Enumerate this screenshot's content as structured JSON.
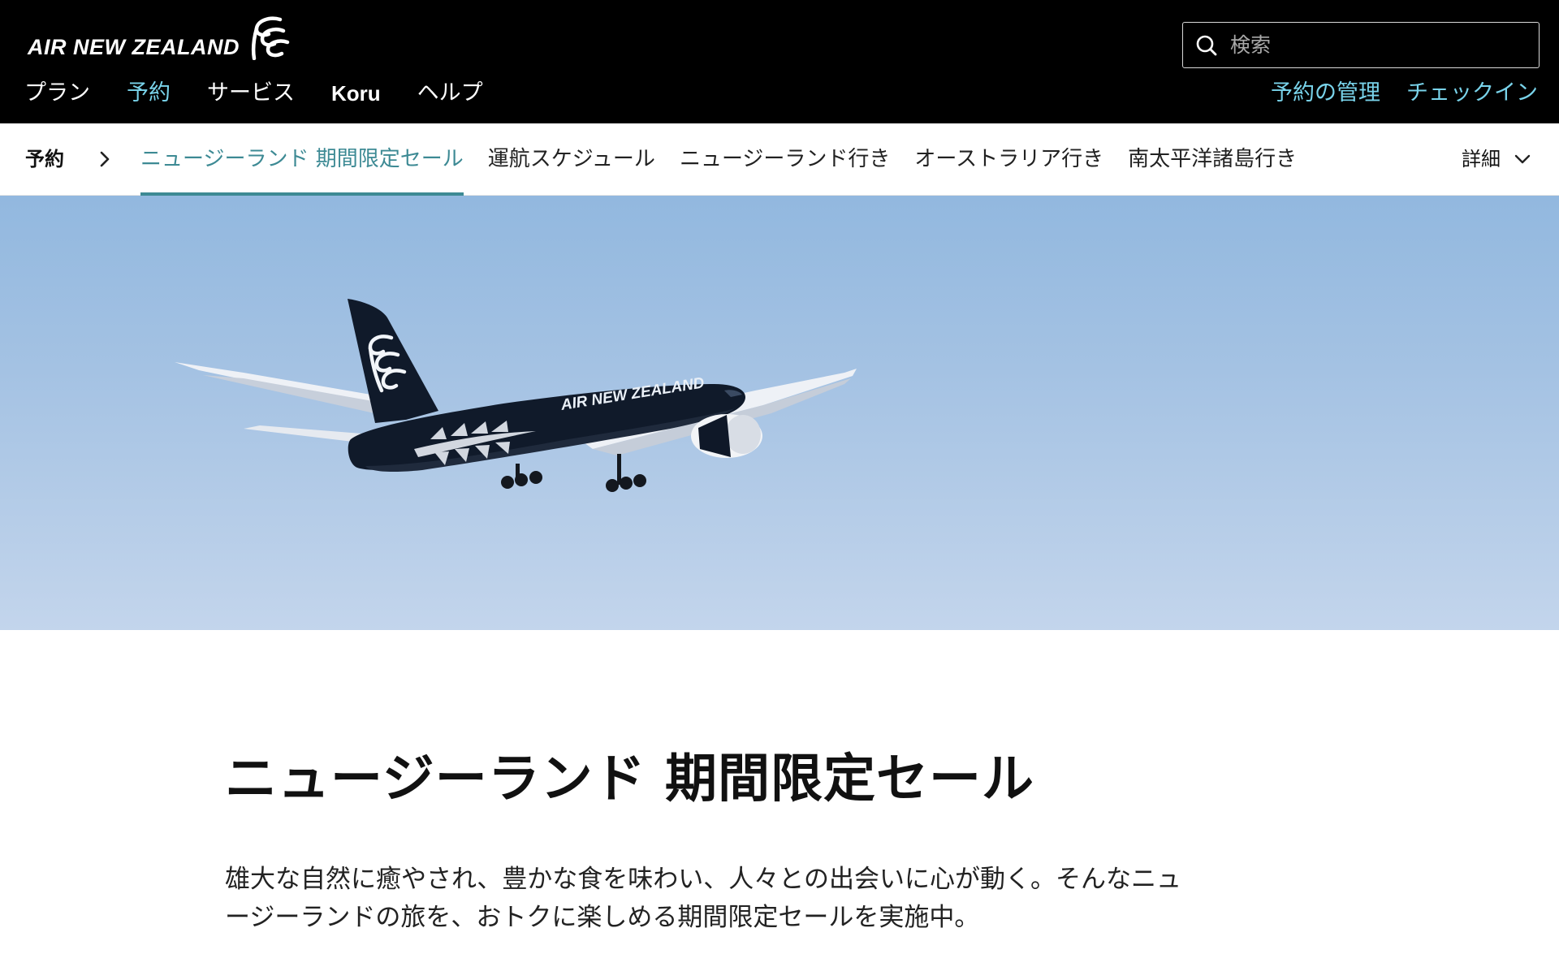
{
  "header": {
    "logo_text": "AIR NEW ZEALAND",
    "main_nav": [
      {
        "label": "プラン",
        "active": false
      },
      {
        "label": "予約",
        "active": true
      },
      {
        "label": "サービス",
        "active": false
      },
      {
        "label": "Koru",
        "active": false
      },
      {
        "label": "ヘルプ",
        "active": false
      }
    ],
    "search": {
      "placeholder": "検索",
      "value": "",
      "icon": "search-icon"
    },
    "util_nav": [
      {
        "label": "予約の管理"
      },
      {
        "label": "チェックイン"
      }
    ]
  },
  "subnav": {
    "root_label": "予約",
    "items": [
      {
        "label": "ニュージーランド 期間限定セール",
        "active": true
      },
      {
        "label": "運航スケジュール",
        "active": false
      },
      {
        "label": "ニュージーランド行き",
        "active": false
      },
      {
        "label": "オーストラリア行き",
        "active": false
      },
      {
        "label": "南太平洋諸島行き",
        "active": false
      }
    ],
    "more_label": "詳細"
  },
  "hero": {
    "aircraft_livery_text": "AIR NEW ZEALAND"
  },
  "main": {
    "title": "ニュージーランド 期間限定セール",
    "intro": "雄大な自然に癒やされ、豊かな食を味わい、人々との出会いに心が動く。そんなニュージーランドの旅を、おトクに楽しめる期間限定セールを実施中。"
  },
  "colors": {
    "header_bg": "#000000",
    "accent_link": "#79d3ea",
    "active_tab": "#3d8a94",
    "sky": "#a4c2e3"
  }
}
